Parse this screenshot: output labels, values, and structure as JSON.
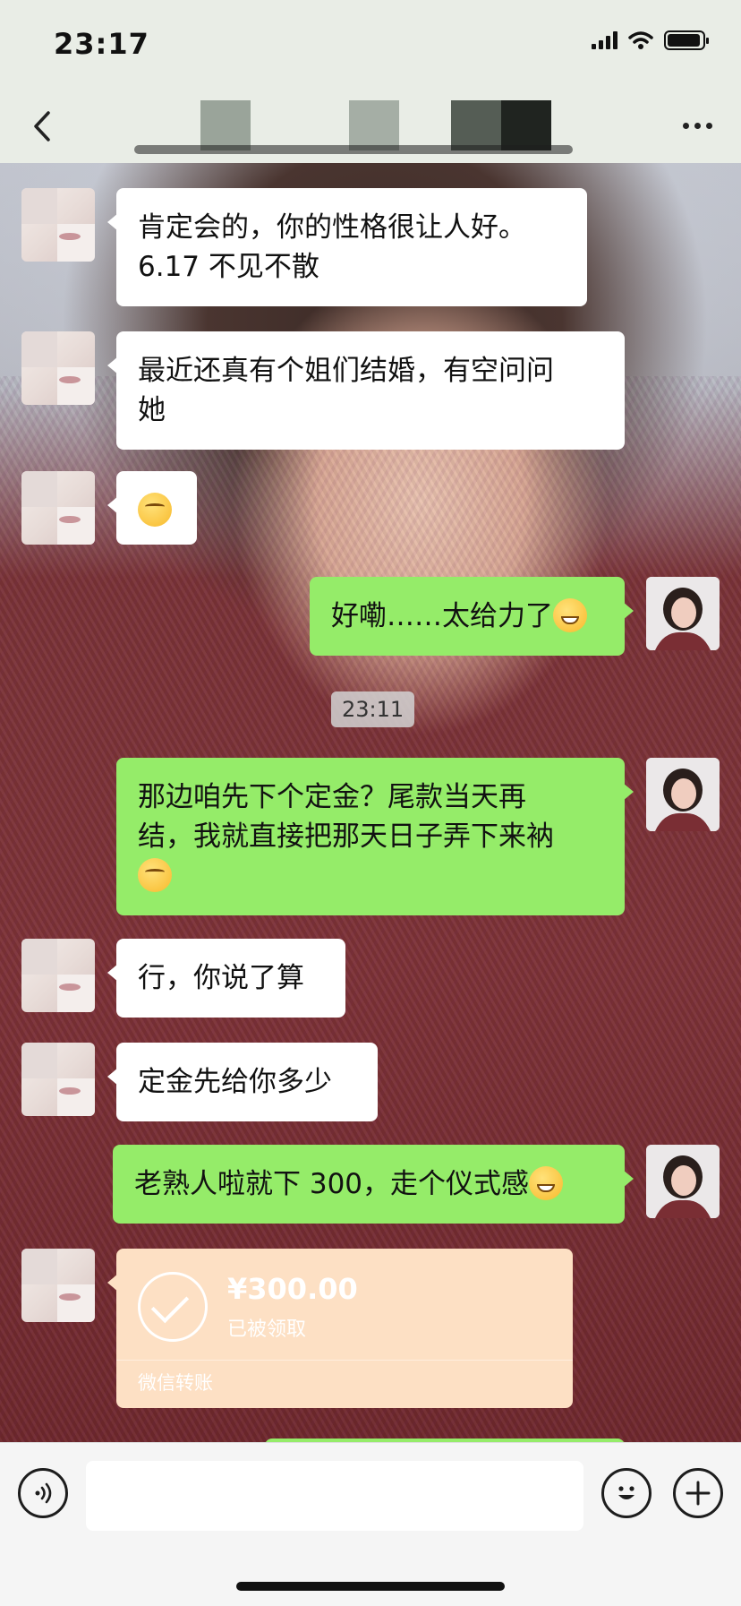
{
  "status_bar": {
    "time": "23:17"
  },
  "colors": {
    "outgoing_bubble": "#95ec69",
    "incoming_bubble": "#ffffff",
    "transfer_card": "#fde0c4",
    "bar_background": "#e9ede6"
  },
  "nav": {
    "back_icon": "chevron-left-icon",
    "more_icon": "more-dots-icon"
  },
  "messages": [
    {
      "side": "in",
      "text_lines": [
        "肯定会的，你的性格很让人好。",
        "6.17 不见不散"
      ]
    },
    {
      "side": "in",
      "text_lines": [
        "最近还真有个姐们结婚，有空问问",
        "她"
      ]
    },
    {
      "side": "in",
      "emoji": "smirk-emoji"
    },
    {
      "side": "out",
      "text": "好嘞……太给力了",
      "emoji": "grin-emoji"
    },
    {
      "side": "out",
      "text_lines": [
        "那边咱先下个定金？尾款当天再",
        "结，我就直接把那天日子弄下来衲"
      ],
      "emoji": "blush-emoji"
    },
    {
      "side": "in",
      "text": "行，你说了算"
    },
    {
      "side": "in",
      "text": "定金先给你多少"
    },
    {
      "side": "out",
      "text": "老熟人啦就下 300，走个仪式感",
      "emoji": "grin-emoji"
    }
  ],
  "timestamp": "23:11",
  "transfer": {
    "amount": "¥300.00",
    "status": "已被领取",
    "label": "微信转账",
    "icon": "check-circle-icon"
  },
  "input_bar": {
    "voice_icon": "voice-icon",
    "emoji_icon": "emoji-icon",
    "plus_icon": "plus-icon",
    "value": ""
  }
}
